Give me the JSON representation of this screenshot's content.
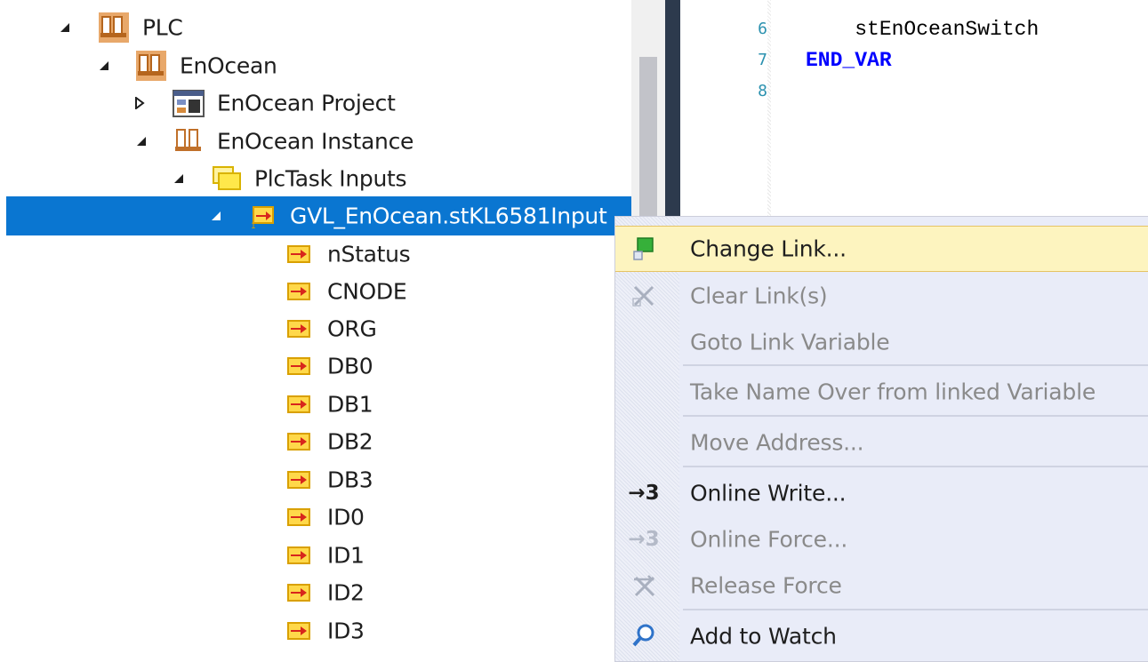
{
  "tree": {
    "items": [
      {
        "label": "PLC",
        "icon": "plc-project-icon"
      },
      {
        "label": "EnOcean",
        "icon": "plc-project-icon"
      },
      {
        "label": "EnOcean Project",
        "icon": "project-window-icon"
      },
      {
        "label": "EnOcean Instance",
        "icon": "instance-icon"
      },
      {
        "label": "PlcTask Inputs",
        "icon": "folder-icon"
      },
      {
        "label": "GVL_EnOcean.stKL6581Input",
        "icon": "input-variable-icon"
      },
      {
        "label": "nStatus",
        "icon": "input-variable-icon"
      },
      {
        "label": "CNODE",
        "icon": "input-variable-icon"
      },
      {
        "label": "ORG",
        "icon": "input-variable-icon"
      },
      {
        "label": "DB0",
        "icon": "input-variable-icon"
      },
      {
        "label": "DB1",
        "icon": "input-variable-icon"
      },
      {
        "label": "DB2",
        "icon": "input-variable-icon"
      },
      {
        "label": "DB3",
        "icon": "input-variable-icon"
      },
      {
        "label": "ID0",
        "icon": "input-variable-icon"
      },
      {
        "label": "ID1",
        "icon": "input-variable-icon"
      },
      {
        "label": "ID2",
        "icon": "input-variable-icon"
      },
      {
        "label": "ID3",
        "icon": "input-variable-icon"
      }
    ]
  },
  "editor": {
    "lines": [
      {
        "number": "6",
        "code": "    stEnOceanSwitch"
      },
      {
        "number": "7",
        "code": "END_VAR"
      },
      {
        "number": "8",
        "code": ""
      }
    ]
  },
  "context_menu": {
    "items": [
      {
        "label": "Change Link...",
        "icon": "change-link-icon",
        "enabled": true,
        "highlighted": true
      },
      {
        "label": "Clear Link(s)",
        "icon": "clear-link-icon",
        "enabled": false
      },
      {
        "label": "Goto Link Variable",
        "icon": "",
        "enabled": false
      },
      {
        "label": "Take Name Over from linked Variable",
        "icon": "",
        "enabled": false
      },
      {
        "label": "Move Address...",
        "icon": "",
        "enabled": false
      },
      {
        "label": "Online Write...",
        "icon": "online-write-icon",
        "enabled": true
      },
      {
        "label": "Online Force...",
        "icon": "online-force-icon",
        "enabled": false
      },
      {
        "label": "Release Force",
        "icon": "release-force-icon",
        "enabled": false
      },
      {
        "label": "Add to Watch",
        "icon": "magnifier-icon",
        "enabled": true
      }
    ],
    "online_write_glyph": "→3",
    "online_force_glyph": "→3"
  },
  "colors": {
    "selection": "#0a76d1",
    "menu_highlight": "#fdf4bf",
    "keyword": "#0000ff",
    "line_number": "#2b91af"
  }
}
